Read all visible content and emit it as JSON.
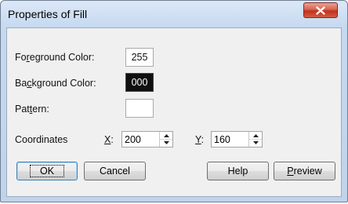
{
  "window": {
    "title": "Properties of Fill"
  },
  "form": {
    "foreground_label_pre": "Fo",
    "foreground_label_key": "r",
    "foreground_label_post": "eground Color:",
    "foreground_value": "255",
    "background_label_pre": "Ba",
    "background_label_key": "c",
    "background_label_post": "kground Color:",
    "background_value": "000",
    "pattern_label_pre": "Pat",
    "pattern_label_key": "t",
    "pattern_label_post": "ern:",
    "coordinates_label": "Coordinates",
    "x_label_key": "X",
    "x_label_post": ":",
    "x_value": "200",
    "y_label_key": "Y",
    "y_label_post": ":",
    "y_value": "160"
  },
  "buttons": {
    "ok": "OK",
    "cancel": "Cancel",
    "help": "Help",
    "preview_key": "P",
    "preview_post": "review"
  },
  "colors": {
    "client_bg": "#f0f0f0",
    "frame_bg": "#c5d9f0",
    "close_red": "#c1331e",
    "background_swatch": "#101010"
  }
}
